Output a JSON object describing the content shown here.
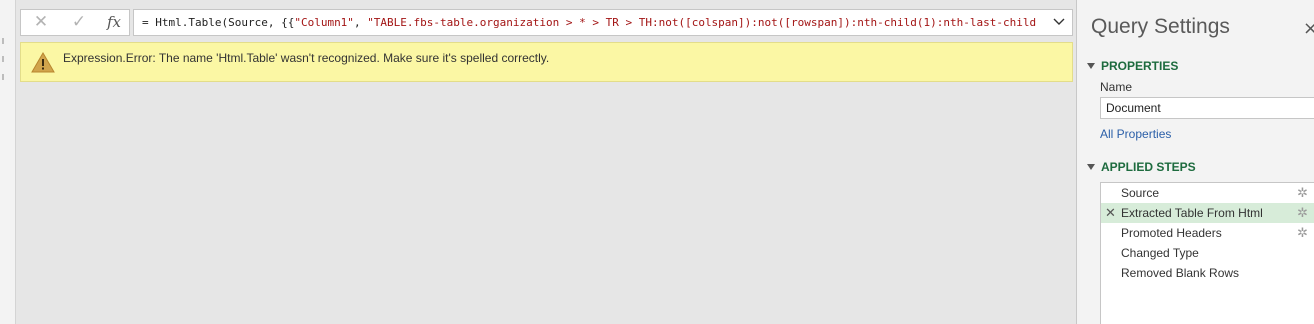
{
  "formula_bar": {
    "cancel_icon": "close-icon",
    "cancel_glyph": "✕",
    "confirm_icon": "check-icon",
    "confirm_glyph": "✓",
    "fx_label": "fx",
    "expression_prefix": "= Html.Table(Source, {{",
    "expression_str1": "\"Column1\"",
    "expression_sep": ", ",
    "expression_str2": "\"TABLE.fbs-table.organization > * > TR > TH:not([colspan]):not([rowspan]):nth-child(1):nth-last-child",
    "expand_icon": "chevron-down-icon"
  },
  "error": {
    "icon": "warning-icon",
    "message": "Expression.Error: The name 'Html.Table' wasn't recognized.  Make sure it's spelled correctly."
  },
  "query_settings": {
    "title": "Query Settings",
    "close_glyph": "×",
    "properties_header": "PROPERTIES",
    "name_label": "Name",
    "name_value": "Document",
    "all_properties_link": "All Properties",
    "applied_steps_header": "APPLIED STEPS",
    "steps": [
      {
        "label": "Source",
        "has_gear": true,
        "selected": false,
        "error": false
      },
      {
        "label": "Extracted Table From Html",
        "has_gear": true,
        "selected": true,
        "error": true
      },
      {
        "label": "Promoted Headers",
        "has_gear": true,
        "selected": false,
        "error": false
      },
      {
        "label": "Changed Type",
        "has_gear": false,
        "selected": false,
        "error": false
      },
      {
        "label": "Removed Blank Rows",
        "has_gear": false,
        "selected": false,
        "error": false
      }
    ]
  },
  "colors": {
    "error_banner_bg": "#fbf7a4",
    "section_header": "#1d6b3e",
    "selected_step_bg": "#d7ecd9",
    "link": "#2b5fa8",
    "string_literal": "#a31515"
  }
}
